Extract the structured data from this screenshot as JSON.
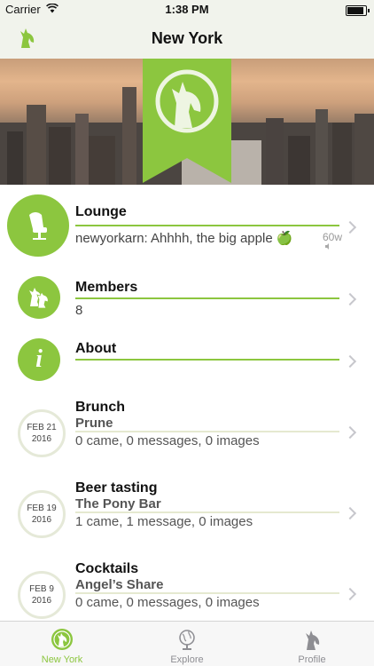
{
  "status_bar": {
    "carrier": "Carrier",
    "time": "1:38 PM"
  },
  "navbar": {
    "title": "New York"
  },
  "lounge": {
    "title": "Lounge",
    "last_message": "newyorkarn: Ahhhh, the big apple 🍏",
    "timestamp": "60w"
  },
  "members": {
    "title": "Members",
    "count": "8"
  },
  "about": {
    "title": "About"
  },
  "events": [
    {
      "month_day": "FEB 21",
      "year": "2016",
      "name": "Brunch",
      "venue": "Prune",
      "stats": "0 came, 0 messages, 0 images"
    },
    {
      "month_day": "FEB 19",
      "year": "2016",
      "name": "Beer tasting",
      "venue": "The Pony Bar",
      "stats": "1 came, 1 message, 0 images"
    },
    {
      "month_day": "FEB 9",
      "year": "2016",
      "name": "Cocktails",
      "venue": "Angel’s Share",
      "stats": "0 came, 0 messages, 0 images"
    }
  ],
  "tabbar": {
    "tabs": [
      {
        "label": "New York",
        "active": true
      },
      {
        "label": "Explore",
        "active": false
      },
      {
        "label": "Profile",
        "active": false
      }
    ]
  },
  "colors": {
    "accent": "#8cc63f",
    "inactive_tab": "#8e8e93"
  }
}
